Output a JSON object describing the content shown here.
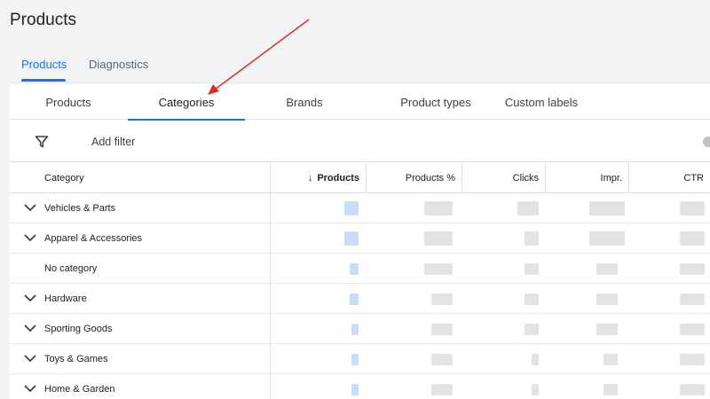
{
  "page": {
    "title": "Products"
  },
  "top_tabs": [
    {
      "label": "Products",
      "active": true
    },
    {
      "label": "Diagnostics",
      "active": false
    }
  ],
  "sub_tabs": [
    {
      "label": "Products",
      "active": false
    },
    {
      "label": "Categories",
      "active": true
    },
    {
      "label": "Brands",
      "active": false
    },
    {
      "label": "Product types",
      "active": false
    },
    {
      "label": "Custom labels",
      "active": false
    }
  ],
  "filter": {
    "add_label": "Add filter",
    "icon": "filter-icon"
  },
  "table": {
    "headers": {
      "category": "Category",
      "products": "Products",
      "products_pct": "Products %",
      "clicks": "Clicks",
      "impr": "Impr.",
      "ctr": "CTR"
    },
    "sort_icon": "arrow-down-icon",
    "rows": [
      {
        "label": "Vehicles & Parts",
        "expandable": true
      },
      {
        "label": "Apparel & Accessories",
        "expandable": true
      },
      {
        "label": "No category",
        "expandable": false
      },
      {
        "label": "Hardware",
        "expandable": true
      },
      {
        "label": "Sporting Goods",
        "expandable": true
      },
      {
        "label": "Toys & Games",
        "expandable": true
      },
      {
        "label": "Home & Garden",
        "expandable": true
      }
    ]
  },
  "colors": {
    "accent": "#1a73e8",
    "annotation_arrow": "#d93025"
  }
}
